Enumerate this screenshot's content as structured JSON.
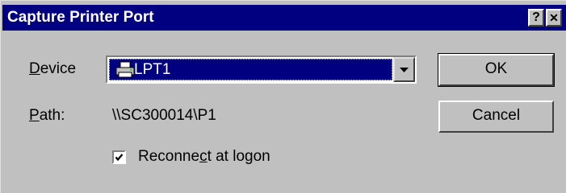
{
  "window": {
    "title": "Capture Printer Port",
    "help_glyph": "?",
    "close_glyph": "✕"
  },
  "device": {
    "label_first": "D",
    "label_rest": "evice",
    "selected": "LPT1",
    "icon": "printer-icon"
  },
  "path": {
    "label_first": "P",
    "label_rest": "ath:",
    "value": "\\\\SC300014\\P1"
  },
  "reconnect": {
    "checked": true,
    "label_pre": "Reconne",
    "label_underlined": "c",
    "label_post": "t at logon"
  },
  "buttons": {
    "ok": "OK",
    "cancel": "Cancel"
  },
  "colors": {
    "title_bar": "#000080",
    "face": "#c0c0c0",
    "selection": "#000080"
  }
}
